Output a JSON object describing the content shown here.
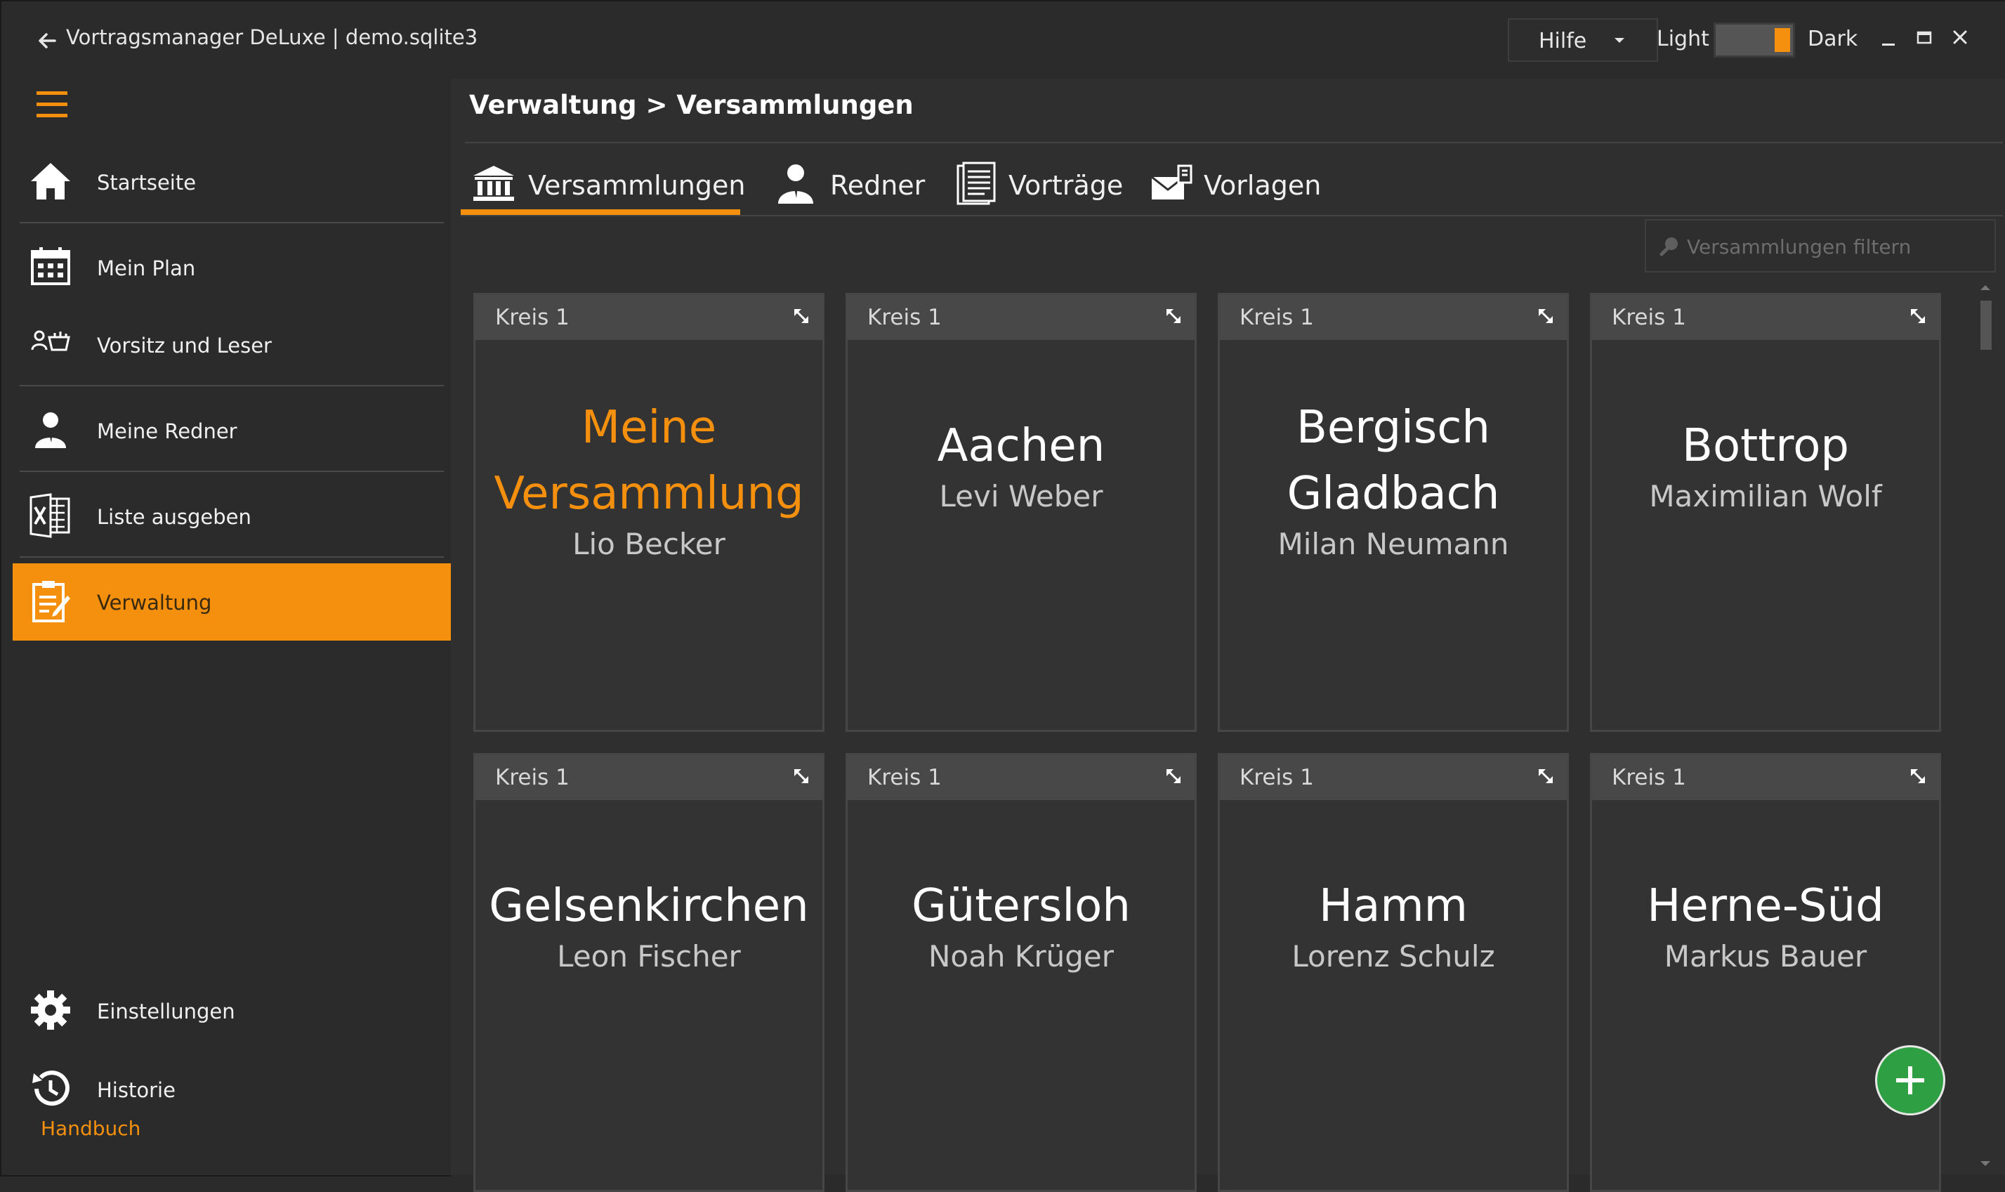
{
  "window": {
    "title": "Vortragsmanager DeLuxe | demo.sqlite3",
    "help_label": "Hilfe",
    "theme_light_label": "Light",
    "theme_dark_label": "Dark",
    "theme_selected": "Dark"
  },
  "sidebar": {
    "items": [
      {
        "label": "Startseite",
        "icon": "home-icon"
      },
      {
        "label": "Mein Plan",
        "icon": "calendar-icon"
      },
      {
        "label": "Vorsitz und Leser",
        "icon": "chair-reader-icon"
      },
      {
        "label": "Meine Redner",
        "icon": "speaker-icon"
      },
      {
        "label": "Liste ausgeben",
        "icon": "excel-icon"
      },
      {
        "label": "Verwaltung",
        "icon": "clipboard-icon",
        "active": true
      }
    ],
    "bottom_items": [
      {
        "label": "Einstellungen",
        "icon": "gear-icon"
      },
      {
        "label": "Historie",
        "icon": "history-icon"
      }
    ],
    "manual_link": "Handbuch",
    "accent_color": "#f5900f"
  },
  "main": {
    "breadcrumb": "Verwaltung > Versammlungen",
    "tabs": [
      {
        "label": "Versammlungen",
        "icon": "building-icon",
        "active": true
      },
      {
        "label": "Redner",
        "icon": "person-icon"
      },
      {
        "label": "Vorträge",
        "icon": "document-icon"
      },
      {
        "label": "Vorlagen",
        "icon": "mail-template-icon"
      }
    ],
    "filter_placeholder": "Versammlungen filtern",
    "cards": [
      {
        "kreis": "Kreis 1",
        "name_lines": [
          "Meine",
          "Versammlung"
        ],
        "person": "Lio Becker",
        "mine": true
      },
      {
        "kreis": "Kreis 1",
        "name_lines": [
          "Aachen"
        ],
        "person": "Levi Weber"
      },
      {
        "kreis": "Kreis 1",
        "name_lines": [
          "Bergisch",
          "Gladbach"
        ],
        "person": "Milan Neumann"
      },
      {
        "kreis": "Kreis 1",
        "name_lines": [
          "Bottrop"
        ],
        "person": "Maximilian Wolf"
      },
      {
        "kreis": "Kreis 1",
        "name_lines": [
          "Gelsenkirchen"
        ],
        "person": "Leon Fischer"
      },
      {
        "kreis": "Kreis 1",
        "name_lines": [
          "Gütersloh"
        ],
        "person": "Noah Krüger"
      },
      {
        "kreis": "Kreis 1",
        "name_lines": [
          "Hamm"
        ],
        "person": "Lorenz Schulz"
      },
      {
        "kreis": "Kreis 1",
        "name_lines": [
          "Herne-Süd"
        ],
        "person": "Markus Bauer"
      }
    ],
    "add_button_icon": "plus-icon",
    "add_button_color": "#2ea043"
  }
}
